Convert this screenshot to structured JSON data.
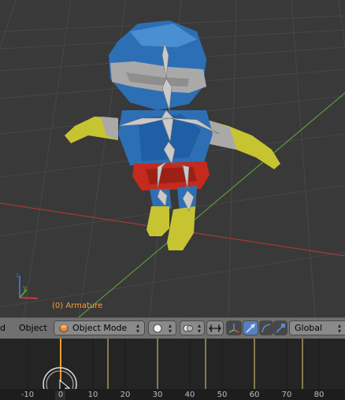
{
  "viewport": {
    "object_label": "(0) Armature"
  },
  "header": {
    "menu_partial": "d",
    "object_menu": "Object",
    "mode_select": "Object Mode",
    "orientation_select": "Global"
  },
  "timeline": {
    "tick_labels": [
      "-10",
      "0",
      "10",
      "20",
      "30",
      "40",
      "50",
      "60",
      "70",
      "80"
    ]
  },
  "colors": {
    "accent_orange": "#ff9d2e",
    "header_gray": "#707070",
    "axis_red": "#a83a3a",
    "axis_green": "#5c9a3a",
    "keyframe_yellow": "#c8b46a"
  }
}
